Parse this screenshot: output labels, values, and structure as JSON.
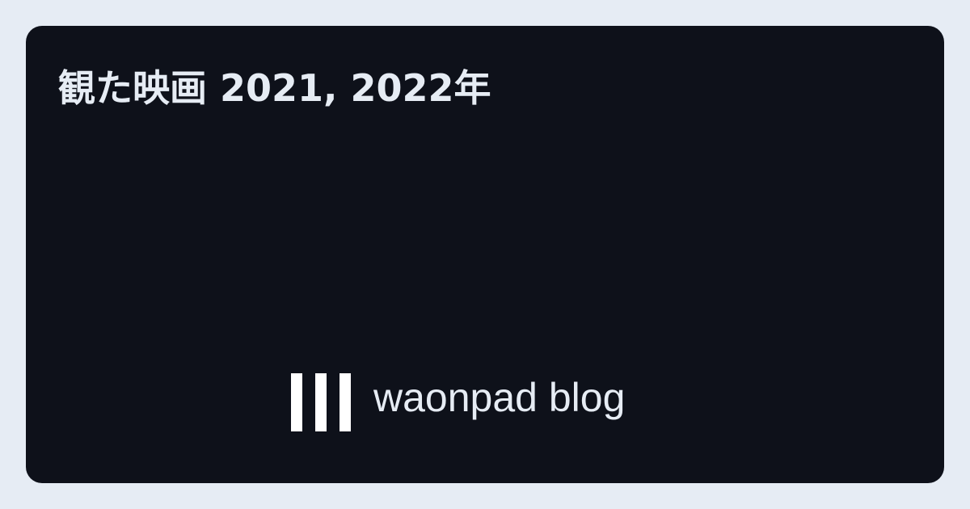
{
  "title": "観た映画 2021, 2022年",
  "brand": {
    "name": "waonpad blog",
    "logo_icon": "three-vertical-bars-icon"
  },
  "colors": {
    "page_background": "#e6ecf4",
    "card_background": "#0e111a",
    "text": "#e6ecf4",
    "logo": "#ffffff"
  }
}
